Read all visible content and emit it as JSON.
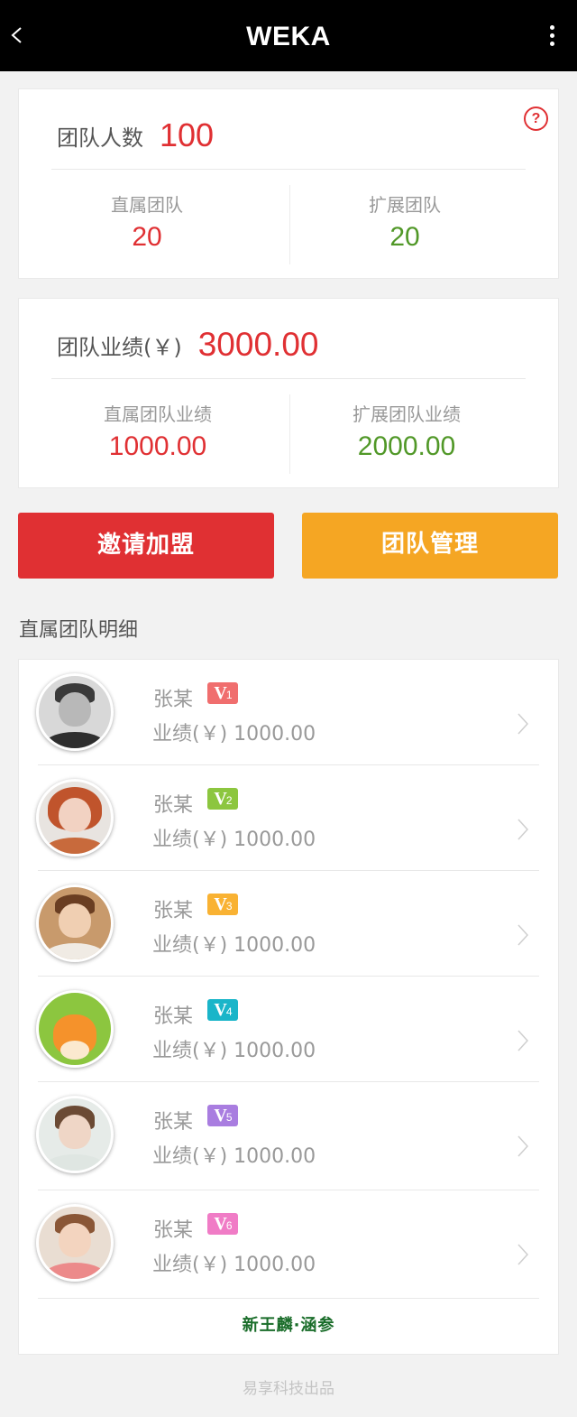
{
  "app": {
    "title": "WEKA",
    "back_icon": "chevron-left-icon",
    "more_icon": "more-vertical-icon"
  },
  "team_count": {
    "label": "团队人数",
    "value": "100",
    "help_icon": "question-circle-icon",
    "help_symbol": "?",
    "direct": {
      "label": "直属团队",
      "value": "20"
    },
    "extended": {
      "label": "扩展团队",
      "value": "20"
    }
  },
  "team_performance": {
    "label": "团队业绩(￥)",
    "value": "3000.00",
    "direct": {
      "label": "直属团队业绩",
      "value": "1000.00"
    },
    "extended": {
      "label": "扩展团队业绩",
      "value": "2000.00"
    }
  },
  "actions": {
    "invite_label": "邀请加盟",
    "manage_label": "团队管理"
  },
  "detail_section": {
    "title": "直属团队明细",
    "members": [
      {
        "name": "张某",
        "level": "V",
        "level_num": "1",
        "badge_color": "#f06e6e",
        "performance": "业绩(￥) 1000.00"
      },
      {
        "name": "张某",
        "level": "V",
        "level_num": "2",
        "badge_color": "#8cc63f",
        "performance": "业绩(￥) 1000.00"
      },
      {
        "name": "张某",
        "level": "V",
        "level_num": "3",
        "badge_color": "#f9b233",
        "performance": "业绩(￥) 1000.00"
      },
      {
        "name": "张某",
        "level": "V",
        "level_num": "4",
        "badge_color": "#1ab5c9",
        "performance": "业绩(￥) 1000.00"
      },
      {
        "name": "张某",
        "level": "V",
        "level_num": "5",
        "badge_color": "#a97de0",
        "performance": "业绩(￥) 1000.00"
      },
      {
        "name": "张某",
        "level": "V",
        "level_num": "6",
        "badge_color": "#f07cc6",
        "performance": "业绩(￥) 1000.00"
      }
    ],
    "brand_text": "新王麟·涵参"
  },
  "footer": {
    "text": "易享科技出品"
  },
  "colors": {
    "accent_red": "#e03033",
    "accent_green": "#519828",
    "accent_orange": "#f5a623",
    "header_bg": "#000000"
  }
}
